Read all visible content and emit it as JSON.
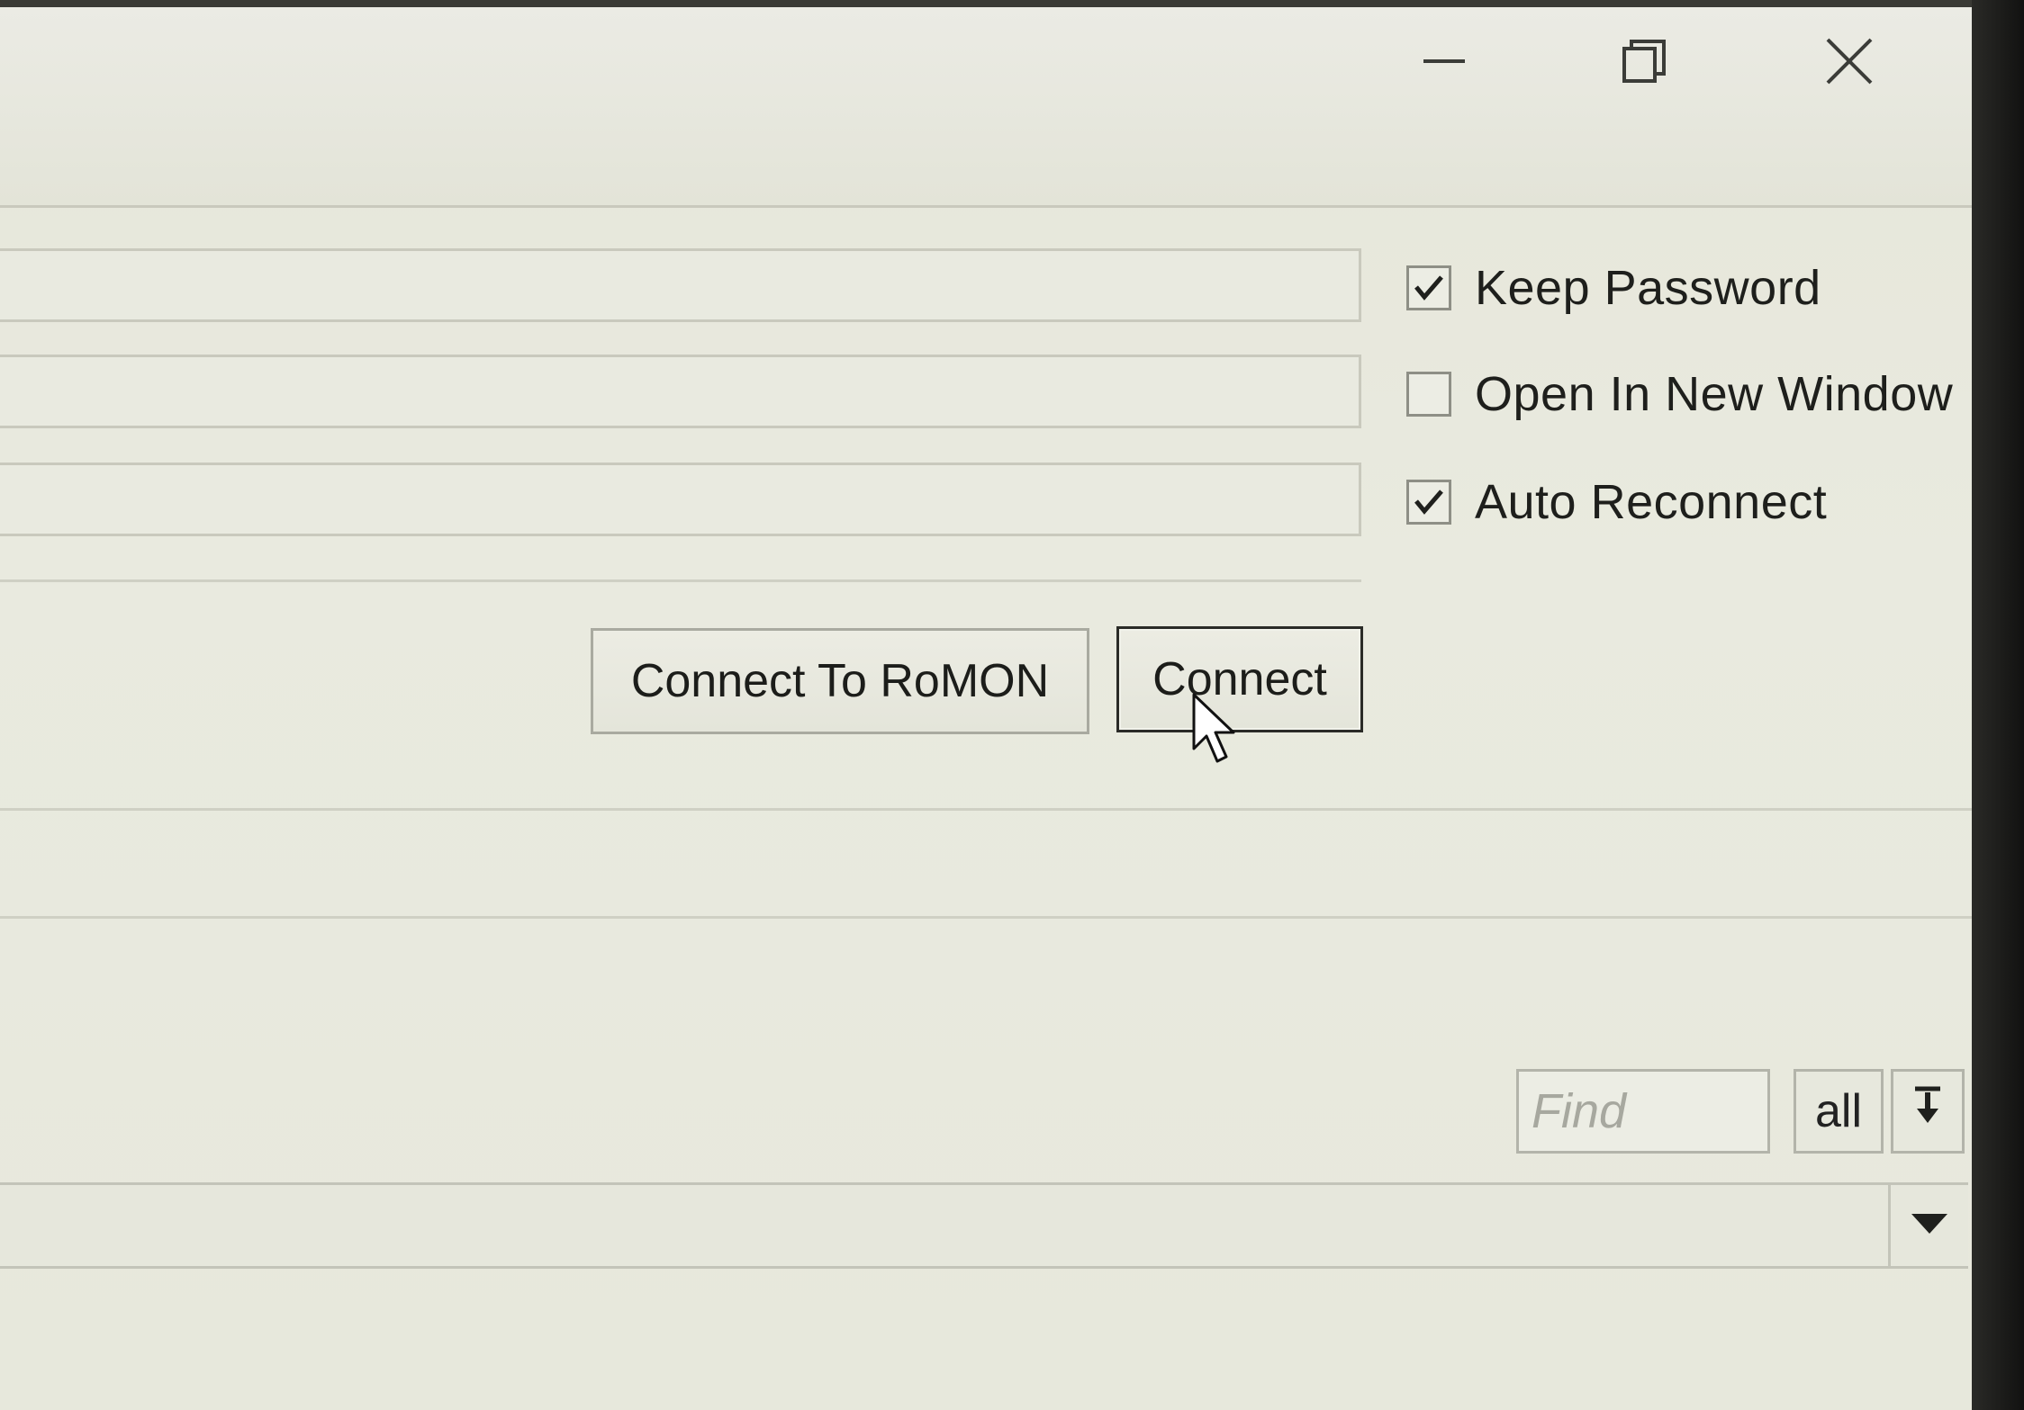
{
  "window_controls": {
    "minimize_icon": "minimize-icon",
    "restore_icon": "restore-icon",
    "close_icon": "close-icon"
  },
  "form": {
    "connect_to_label": "",
    "login_label": "",
    "password_label": ""
  },
  "options": {
    "keep_password": {
      "label": "Keep Password",
      "checked": true
    },
    "open_in_new_window": {
      "label": "Open In New Window",
      "checked": false
    },
    "auto_reconnect": {
      "label": "Auto Reconnect",
      "checked": true
    }
  },
  "buttons": {
    "connect_to_romon": "Connect To RoMON",
    "connect": "Connect"
  },
  "list_toolbar": {
    "find_placeholder": "Find",
    "filter_all": "all",
    "sort_icon": "sort-down-icon"
  },
  "combo": {
    "arrow_icon": "dropdown-arrow-icon"
  }
}
